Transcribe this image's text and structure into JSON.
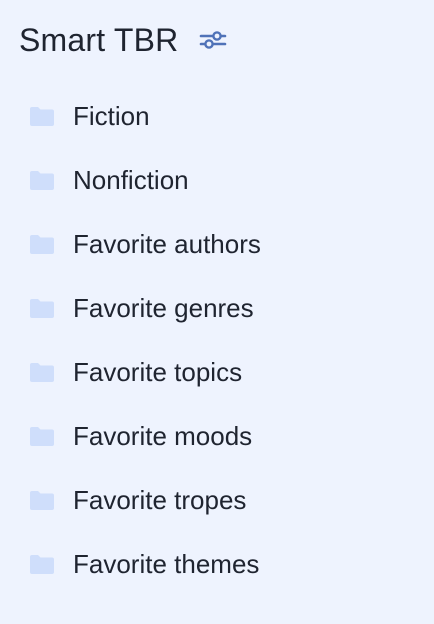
{
  "header": {
    "title": "Smart TBR",
    "filter_icon": "sliders-icon"
  },
  "colors": {
    "background": "#eef3fe",
    "folder": "#cfdefb",
    "accent": "#4f72b8",
    "text": "#1f2430"
  },
  "folders": [
    {
      "label": "Fiction",
      "icon": "folder-icon"
    },
    {
      "label": "Nonfiction",
      "icon": "folder-icon"
    },
    {
      "label": "Favorite authors",
      "icon": "folder-icon"
    },
    {
      "label": "Favorite genres",
      "icon": "folder-icon"
    },
    {
      "label": "Favorite topics",
      "icon": "folder-icon"
    },
    {
      "label": "Favorite moods",
      "icon": "folder-icon"
    },
    {
      "label": "Favorite tropes",
      "icon": "folder-icon"
    },
    {
      "label": "Favorite themes",
      "icon": "folder-icon"
    }
  ]
}
